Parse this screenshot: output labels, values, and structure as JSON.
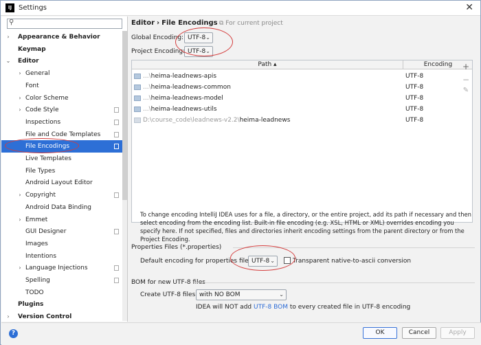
{
  "window": {
    "title": "Settings",
    "app_icon": "IJ"
  },
  "sidebar": {
    "search_placeholder": "",
    "items": [
      {
        "label": "Appearance & Behavior",
        "bold": true,
        "arrow": "›"
      },
      {
        "label": "Keymap",
        "bold": true,
        "arrow": ""
      },
      {
        "label": "Editor",
        "bold": true,
        "arrow": "⌄"
      },
      {
        "label": "General",
        "arrow": "›"
      },
      {
        "label": "Font",
        "arrow": ""
      },
      {
        "label": "Color Scheme",
        "arrow": "›"
      },
      {
        "label": "Code Style",
        "arrow": "›",
        "copy": true
      },
      {
        "label": "Inspections",
        "arrow": "",
        "copy": true
      },
      {
        "label": "File and Code Templates",
        "arrow": "",
        "copy": true
      },
      {
        "label": "File Encodings",
        "arrow": "",
        "copy": true,
        "selected": true
      },
      {
        "label": "Live Templates",
        "arrow": ""
      },
      {
        "label": "File Types",
        "arrow": ""
      },
      {
        "label": "Android Layout Editor",
        "arrow": ""
      },
      {
        "label": "Copyright",
        "arrow": "›",
        "copy": true
      },
      {
        "label": "Android Data Binding",
        "arrow": ""
      },
      {
        "label": "Emmet",
        "arrow": "›"
      },
      {
        "label": "GUI Designer",
        "arrow": "",
        "copy": true
      },
      {
        "label": "Images",
        "arrow": ""
      },
      {
        "label": "Intentions",
        "arrow": ""
      },
      {
        "label": "Language Injections",
        "arrow": "›",
        "copy": true
      },
      {
        "label": "Spelling",
        "arrow": "",
        "copy": true
      },
      {
        "label": "TODO",
        "arrow": ""
      },
      {
        "label": "Plugins",
        "bold": true,
        "arrow": ""
      },
      {
        "label": "Version Control",
        "bold": true,
        "arrow": "›"
      }
    ]
  },
  "breadcrumb": {
    "parent": "Editor",
    "separator": "›",
    "current": "File Encodings",
    "scope": "For current project"
  },
  "global_encoding": {
    "label": "Global Encoding:",
    "value": "UTF-8"
  },
  "project_encoding": {
    "label": "Project Encoding:",
    "value": "UTF-8"
  },
  "table": {
    "col_path": "Path ▴",
    "col_encoding": "Encoding",
    "rows": [
      {
        "prefix": "...\\",
        "name": "heima-leadnews-apis",
        "encoding": "UTF-8"
      },
      {
        "prefix": "...\\",
        "name": "heima-leadnews-common",
        "encoding": "UTF-8"
      },
      {
        "prefix": "...\\",
        "name": "heima-leadnews-model",
        "encoding": "UTF-8"
      },
      {
        "prefix": "...\\",
        "name": "heima-leadnews-utils",
        "encoding": "UTF-8"
      },
      {
        "prefix": "D:\\course_code\\leadnews-v2.2\\",
        "name": "heima-leadnews",
        "encoding": "UTF-8"
      }
    ]
  },
  "hint": "To change encoding IntelliJ IDEA uses for a file, a directory, or the entire project, add its path if necessary and then select encoding from the encoding list. Built-in file encoding (e.g. XSL, HTML or XML) overrides encoding you specify here. If not specified, files and directories inherit encoding settings from the parent directory or from the Project Encoding.",
  "properties": {
    "section": "Properties Files (*.properties)",
    "label": "Default encoding for properties files:",
    "value": "UTF-8",
    "checkbox": "Transparent native-to-ascii conversion"
  },
  "bom": {
    "section": "BOM for new UTF-8 files",
    "label": "Create UTF-8 files:",
    "value": "with NO BOM",
    "note_prefix": "IDEA will NOT add",
    "note_link": "UTF-8 BOM",
    "note_suffix": "to every created file in UTF-8 encoding"
  },
  "buttons": {
    "ok": "OK",
    "cancel": "Cancel",
    "apply": "Apply",
    "help": "?"
  }
}
